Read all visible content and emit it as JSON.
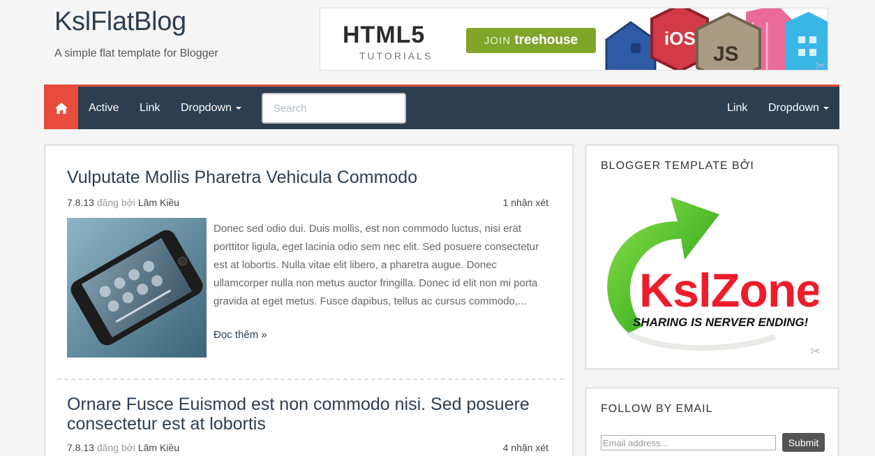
{
  "header": {
    "title": "KslFlatBlog",
    "description": "A simple flat template for Blogger"
  },
  "banner": {
    "headline": "HTML5",
    "subline": "TUTORIALS",
    "join_prefix": "JOIN",
    "join_brand": "treehouse",
    "badges": [
      "iOS",
      "JS"
    ]
  },
  "nav": {
    "home_icon": "home-icon",
    "items_left": [
      {
        "label": "Active"
      },
      {
        "label": "Link"
      },
      {
        "label": "Dropdown"
      }
    ],
    "search_placeholder": "Search",
    "items_right": [
      {
        "label": "Link"
      },
      {
        "label": "Dropdown"
      }
    ]
  },
  "posts": [
    {
      "title": "Vulputate Mollis Pharetra Vehicula Commodo",
      "date": "7.8.13",
      "posted_by": "đăng bởi",
      "author": "Lâm Kiều",
      "comments": "1 nhận xét",
      "excerpt": "Donec sed odio dui. Duis mollis, est non commodo luctus, nisi erat porttitor ligula, eget lacinia odio sem nec elit. Sed posuere consectetur est at lobortis. Nulla vitae elit libero, a pharetra augue. Donec ullamcorper nulla non metus auctor fringilla. Donec id elit non mi porta gravida at eget metus. Fusce dapibus, tellus ac cursus commodo,...",
      "read_more": "Đọc thêm »"
    },
    {
      "title": "Ornare Fusce Euismod est non commodo nisi. Sed posuere consectetur est at lobortis",
      "date": "7.8.13",
      "posted_by": "đăng bởi",
      "author": "Lâm Kiều",
      "comments": "4 nhận xét"
    }
  ],
  "sidebar": {
    "template_widget": {
      "title": "Blogger Template Bởi",
      "logo_text": "KslZone",
      "logo_tagline": "SHARING IS NERVER ENDING!"
    },
    "follow_widget": {
      "title": "Follow by Email",
      "email_placeholder": "Email address...",
      "submit_label": "Submit"
    }
  },
  "colors": {
    "nav_bg": "#2c3e50",
    "accent": "#e74c3c",
    "link": "#2c3e50"
  }
}
